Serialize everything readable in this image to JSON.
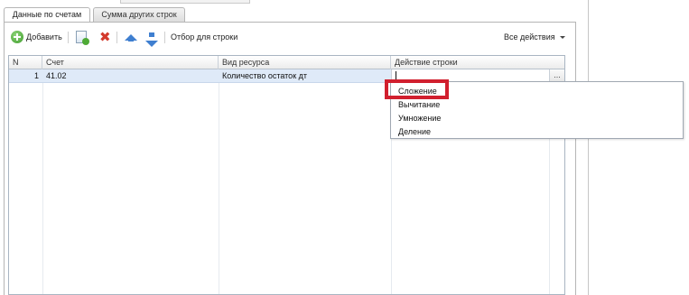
{
  "tabs": [
    {
      "label": "Данные по счетам",
      "active": true
    },
    {
      "label": "Сумма других строк",
      "active": false
    }
  ],
  "toolbar": {
    "add_label": "Добавить",
    "copy_icon": "copy-add-icon",
    "delete_icon": "delete-icon",
    "move_up_icon": "arrow-up-icon",
    "move_down_icon": "arrow-down-icon",
    "filter_label": "Отбор для строки",
    "all_actions_label": "Все действия"
  },
  "table": {
    "columns": [
      "N",
      "Счет",
      "Вид ресурса",
      "Действие строки"
    ],
    "rows": [
      {
        "n": "1",
        "account": "41.02",
        "resource": "Количество остаток дт",
        "action": ""
      }
    ],
    "ellipsis": "..."
  },
  "dropdown": {
    "options": [
      "Сложение",
      "Вычитание",
      "Умножение",
      "Деление"
    ],
    "highlighted": "Сложение"
  },
  "colors": {
    "selected_row": "#dfeaf8",
    "highlight_frame": "#d11f2e",
    "accent_blue": "#3f7fd0"
  }
}
